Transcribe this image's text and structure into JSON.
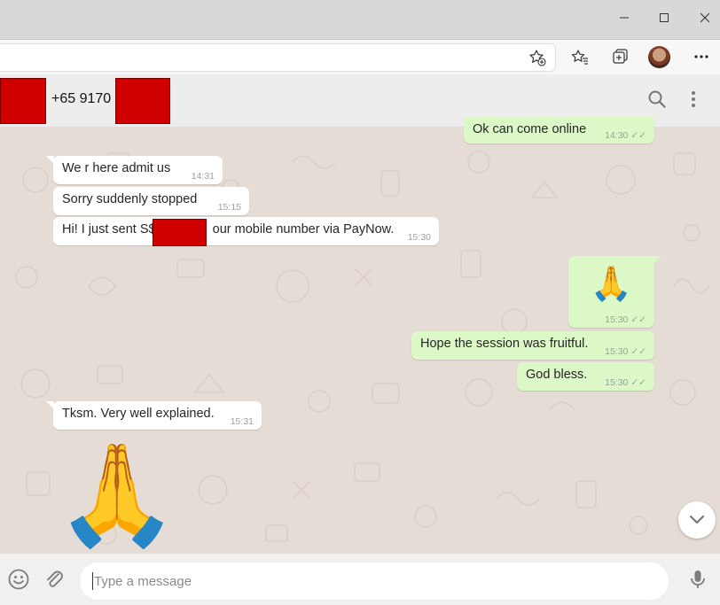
{
  "header": {
    "phone": "+65 9170"
  },
  "messages": {
    "out_top": {
      "text": "Ok can come online",
      "time": "14:30"
    },
    "in_1": {
      "text": "We r here admit us",
      "time": "14:31"
    },
    "in_2": {
      "text": "Sorry suddenly stopped",
      "time": "15:15"
    },
    "in_3": {
      "text_before": "Hi! I just sent S$",
      "text_after": "our mobile number via PayNow.",
      "time": "15:30"
    },
    "out_emoji": {
      "emoji": "🙏",
      "time": "15:30"
    },
    "out_1": {
      "text": "Hope the session was fruitful.",
      "time": "15:30"
    },
    "out_2": {
      "text": "God bless.",
      "time": "15:30"
    },
    "in_4": {
      "text": "Tksm. Very well explained.",
      "time": "15:31"
    },
    "in_sticker": {
      "emoji": "🙏"
    }
  },
  "composer": {
    "placeholder": "Type a message"
  },
  "icons": {
    "minimize": "minimize-icon",
    "maximize": "maximize-icon",
    "close": "close-icon",
    "favorite_add": "star-plus-icon",
    "favorites": "favorites-icon",
    "collections": "collections-icon",
    "more": "more-icon",
    "search": "search-icon",
    "menu": "menu-icon",
    "emoji": "emoji-icon",
    "attach": "paperclip-icon",
    "mic": "mic-icon",
    "scroll_down": "chevron-down-icon"
  },
  "colors": {
    "incoming_bubble": "#ffffff",
    "outgoing_bubble": "#dcf8c6",
    "chat_background": "#e5ddd5",
    "redaction": "#d10000"
  }
}
